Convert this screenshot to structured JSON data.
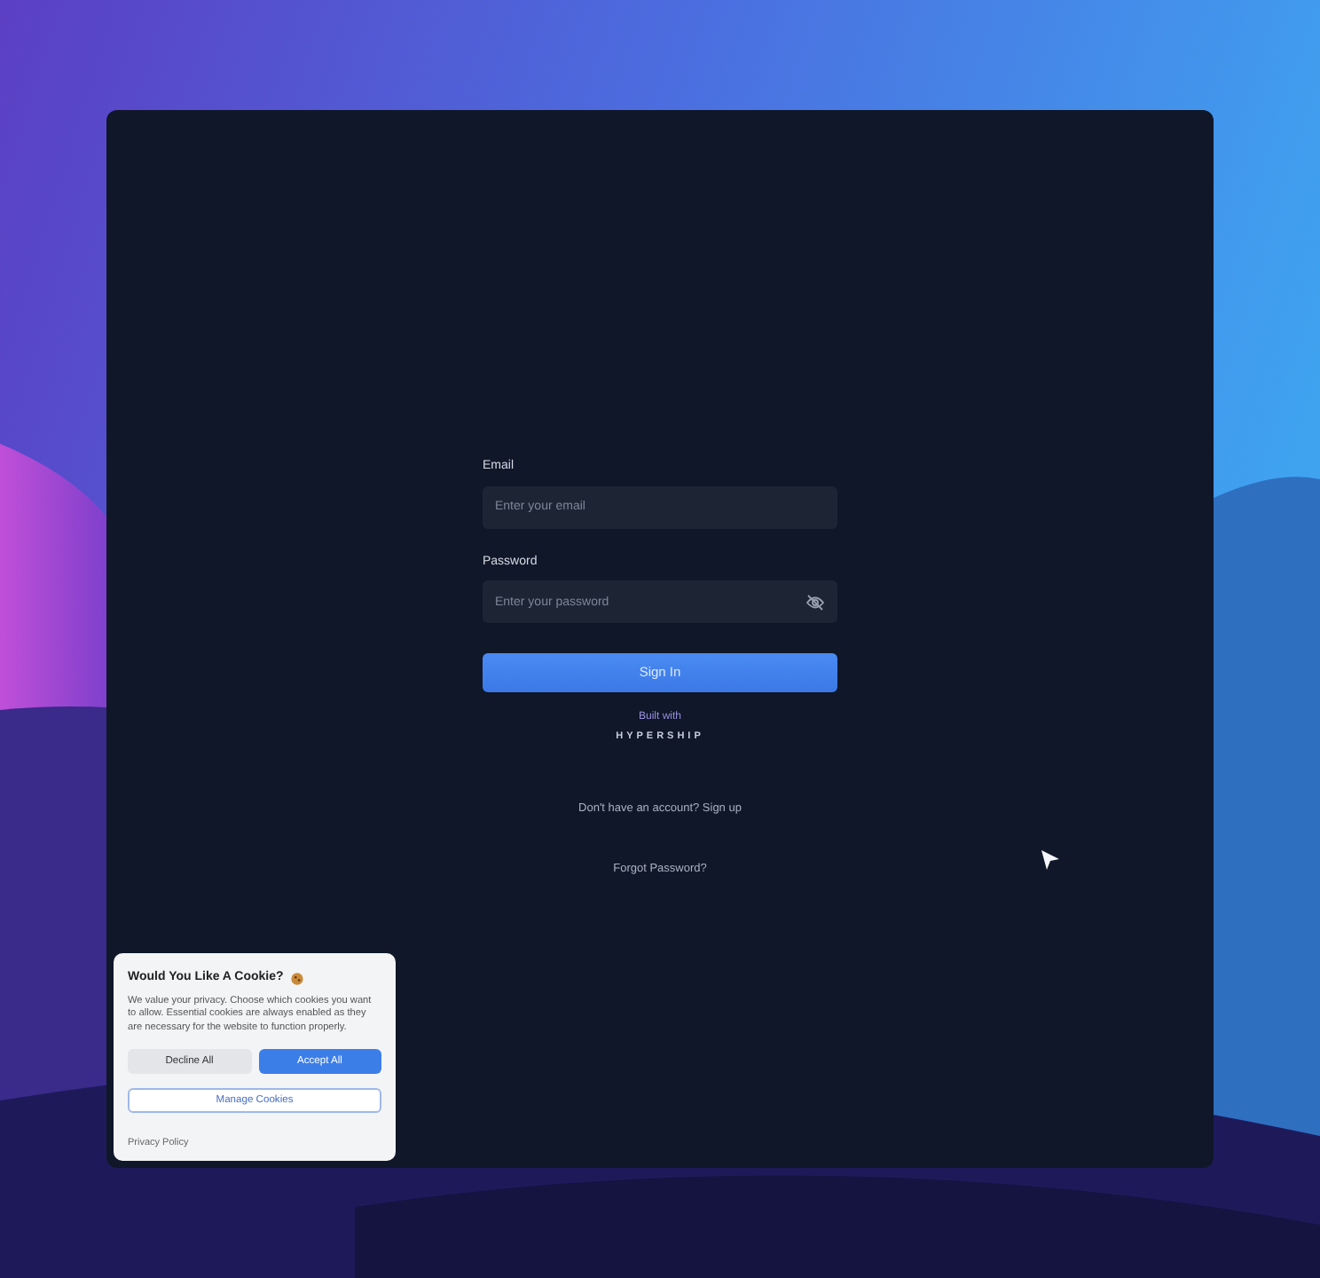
{
  "login": {
    "fields": [
      {
        "label": "Email",
        "placeholder": "Enter your email",
        "kind": "text"
      },
      {
        "label": "Password",
        "placeholder": "Enter your password",
        "kind": "password"
      }
    ],
    "submit": "Sign In",
    "built_with": "Built with",
    "brand": "HYPERSHIP",
    "signup": "Don't have an account? Sign up",
    "forgot": "Forgot Password?"
  },
  "cookie": {
    "title": "Would You Like A Cookie?",
    "text": "We value your privacy. Choose which cookies you want to allow. Essential cookies are always enabled as they are necessary for the website to function properly.",
    "buttons": [
      {
        "label": "Decline All",
        "kind": "secondary"
      },
      {
        "label": "Accept All",
        "kind": "primary"
      }
    ],
    "manage": "Manage Cookies",
    "policy": "Privacy Policy"
  }
}
